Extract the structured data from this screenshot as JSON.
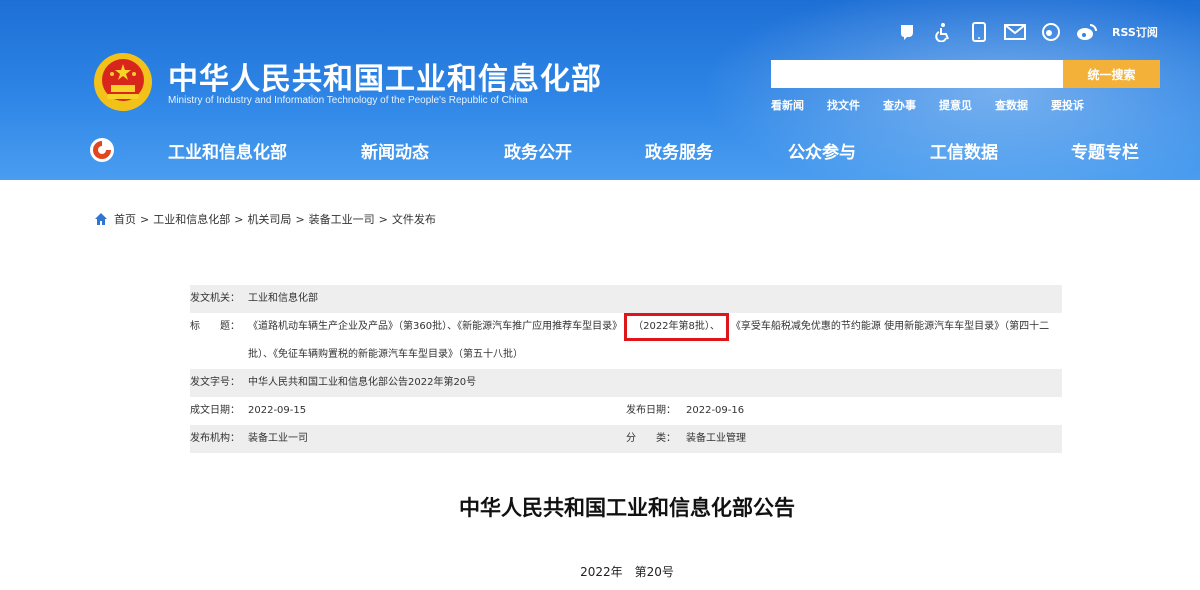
{
  "header": {
    "site_title": "中华人民共和国工业和信息化部",
    "site_subtitle": "Ministry of Industry and Information Technology of the People's Republic of China",
    "top_icons": [
      "wechat-icon",
      "accessibility-icon",
      "mobile-icon",
      "mail-icon",
      "weibo-alt-icon",
      "weibo-icon"
    ],
    "rss_label": "RSS订阅",
    "search_placeholder": "",
    "search_button": "统一搜索",
    "quick_links": [
      "看新闻",
      "找文件",
      "查办事",
      "提意见",
      "查数据",
      "要投诉"
    ]
  },
  "nav": {
    "items": [
      "工业和信息化部",
      "新闻动态",
      "政务公开",
      "政务服务",
      "公众参与",
      "工信数据",
      "专题专栏"
    ]
  },
  "breadcrumb": {
    "items": [
      "首页",
      "工业和信息化部",
      "机关司局",
      "装备工业一司",
      "文件发布"
    ],
    "separator": ">"
  },
  "meta": {
    "issuer_label": "发文机关：",
    "issuer_value": "工业和信息化部",
    "title_label": "标　　题：",
    "title_part1": "《道路机动车辆生产企业及产品》（第360批）、《新能源汽车推广应用推荐车型目录》",
    "title_highlight": "（2022年第8批）、",
    "title_part2": "《享受车船税减免优惠的节约能源 使用新能源汽车车型目录》（第四十二批）、《免征车辆购置税的新能源汽车车型目录》（第五十八批）",
    "docno_label": "发文字号：",
    "docno_value": "中华人民共和国工业和信息化部公告2022年第20号",
    "date_label": "成文日期：",
    "date_value": "2022-09-15",
    "pub_label": "发布日期：",
    "pub_value": "2022-09-16",
    "org_label": "发布机构：",
    "org_value": "装备工业一司",
    "cat_label": "分　　类：",
    "cat_value": "装备工业管理"
  },
  "document": {
    "title": "中华人民共和国工业和信息化部公告",
    "number": "2022年　第20号"
  },
  "colors": {
    "header_blue": "#2f86e6",
    "search_button": "#f3b13a",
    "highlight_border": "#e0151a",
    "row_shade": "#eeeeee"
  }
}
